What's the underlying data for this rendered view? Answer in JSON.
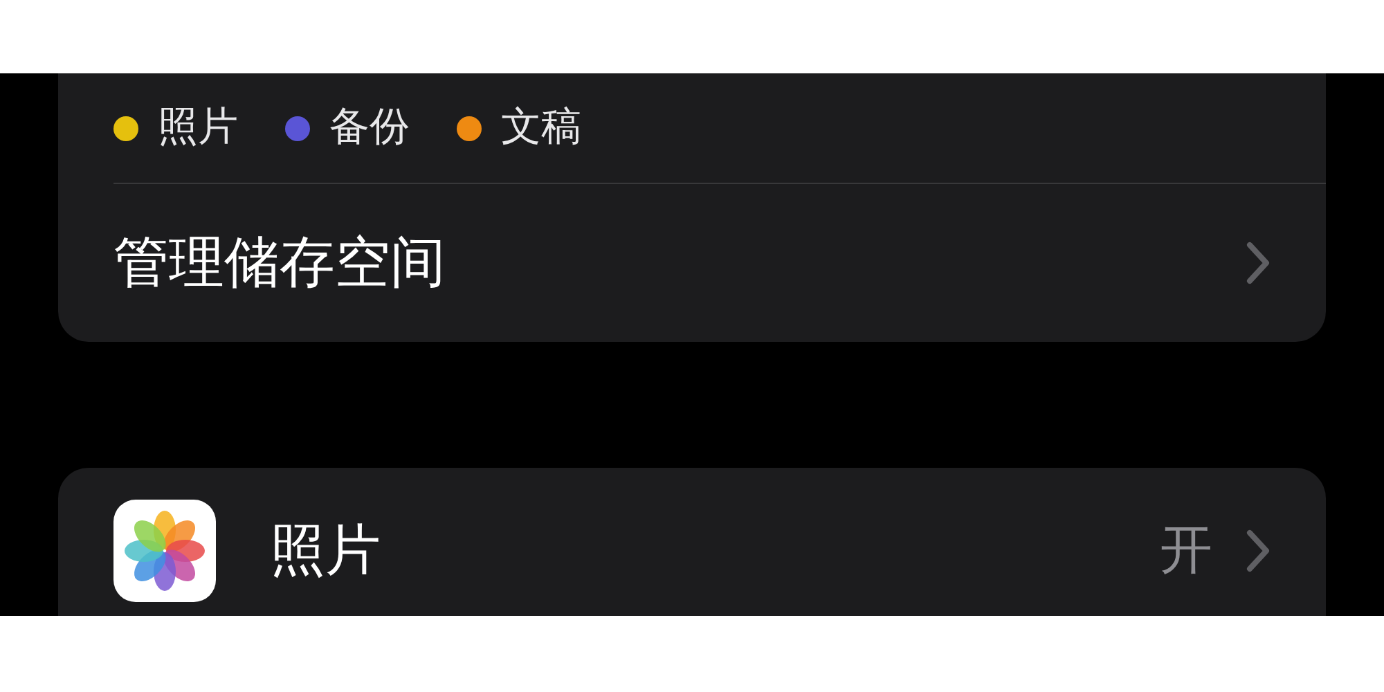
{
  "legend": [
    {
      "label": "照片",
      "color": "#e5c00e"
    },
    {
      "label": "备份",
      "color": "#5a55d6"
    },
    {
      "label": "文稿",
      "color": "#ee8a12"
    }
  ],
  "manage_storage": {
    "label": "管理储存空间"
  },
  "apps": [
    {
      "name": "照片",
      "value": "开"
    }
  ]
}
